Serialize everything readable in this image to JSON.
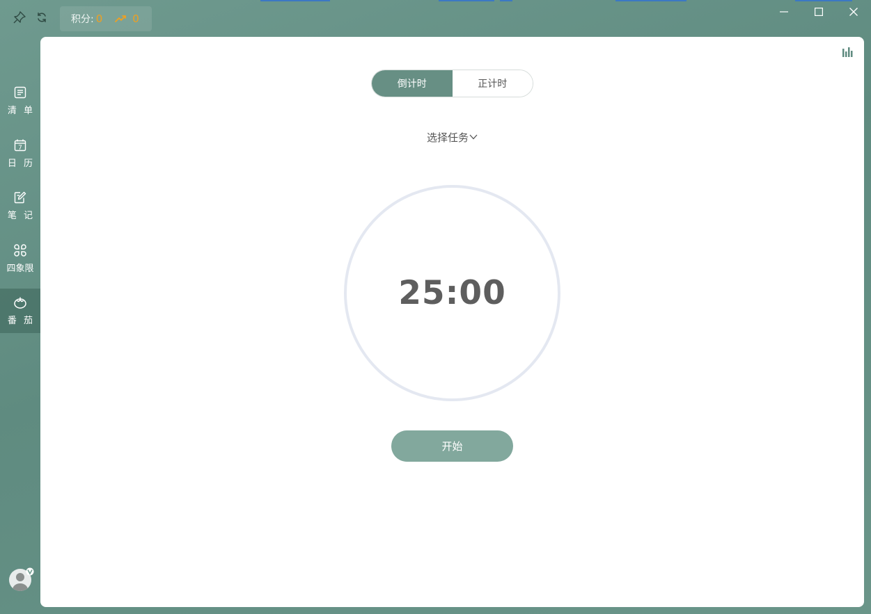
{
  "toolbar": {
    "pin_icon": "pin-icon",
    "sync_icon": "refresh-icon",
    "score_label": "积分:",
    "score_value": "0",
    "trend_value": "0",
    "accent_color": "#f0a020"
  },
  "window_controls": {
    "minimize": "minimize-icon",
    "maximize": "maximize-icon",
    "close": "close-icon"
  },
  "sidebar": {
    "items": [
      {
        "label": "清 单",
        "icon": "list-icon",
        "active": false
      },
      {
        "label": "日 历",
        "icon": "calendar-icon",
        "active": false,
        "icon_text": "7"
      },
      {
        "label": "笔 记",
        "icon": "note-edit-icon",
        "active": false
      },
      {
        "label": "四象限",
        "icon": "quadrant-icon",
        "active": false
      },
      {
        "label": "番 茄",
        "icon": "tomato-icon",
        "active": true
      }
    ]
  },
  "main": {
    "tabs": [
      {
        "label": "倒计时",
        "selected": true
      },
      {
        "label": "正计时",
        "selected": false
      }
    ],
    "task_select": {
      "label": "选择任务"
    },
    "timer": {
      "value": "25:00"
    },
    "start_button": {
      "label": "开始"
    },
    "stats_icon": "bar-chart-icon"
  },
  "theme": {
    "primary": "#678f84",
    "start_button": "#82a89d",
    "ring": "#e4e8f1"
  }
}
